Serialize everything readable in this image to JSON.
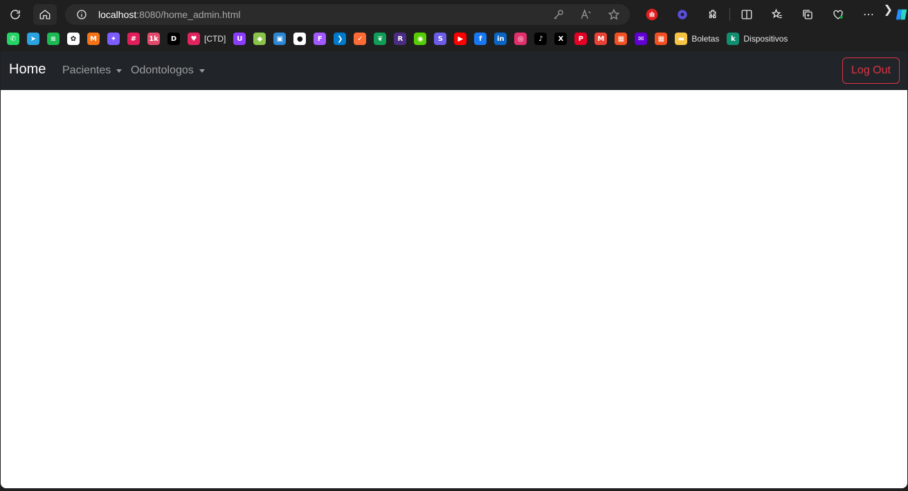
{
  "browser": {
    "address_bar": {
      "host": "localhost",
      "path": ":8080/home_admin.html"
    },
    "bookmarks": [
      {
        "icon": "whatsapp-icon",
        "color": "#25d366",
        "glyph": "✆",
        "label": ""
      },
      {
        "icon": "telegram-icon",
        "color": "#2aa3e0",
        "glyph": "➤",
        "label": ""
      },
      {
        "icon": "spotify-icon",
        "color": "#1db954",
        "glyph": "≋",
        "label": ""
      },
      {
        "icon": "chatgpt-icon",
        "color": "#ffffff",
        "glyph": "✿",
        "label": ""
      },
      {
        "icon": "m-logo-icon",
        "color": "#f97316",
        "glyph": "M",
        "label": ""
      },
      {
        "icon": "sparkle-icon",
        "color": "#7c5cff",
        "glyph": "✦",
        "label": ""
      },
      {
        "icon": "slack-icon",
        "color": "#e01e5a",
        "glyph": "#",
        "label": ""
      },
      {
        "icon": "1k-plus-icon",
        "color": "#e04b6a",
        "glyph": "1k",
        "label": ""
      },
      {
        "icon": "dm-icon",
        "color": "#000000",
        "glyph": "D",
        "label": ""
      },
      {
        "icon": "ctd-icon",
        "color": "#e0245e",
        "glyph": "♥",
        "label": "[CTD]"
      },
      {
        "icon": "purple-u-icon",
        "color": "#8b3dff",
        "glyph": "U",
        "label": ""
      },
      {
        "icon": "diamond-icon",
        "color": "#8bc34a",
        "glyph": "◆",
        "label": ""
      },
      {
        "icon": "window-icon",
        "color": "#2b87d3",
        "glyph": "▣",
        "label": ""
      },
      {
        "icon": "github-icon",
        "color": "#ffffff",
        "glyph": "●",
        "label": ""
      },
      {
        "icon": "figma-icon",
        "color": "#a259ff",
        "glyph": "F",
        "label": ""
      },
      {
        "icon": "vscode-icon",
        "color": "#007acc",
        "glyph": "❯",
        "label": ""
      },
      {
        "icon": "orange-circle-icon",
        "color": "#ff6b35",
        "glyph": "✓",
        "label": ""
      },
      {
        "icon": "green-leaf-icon",
        "color": "#0f9d58",
        "glyph": "❦",
        "label": ""
      },
      {
        "icon": "r-icon",
        "color": "#4b2e83",
        "glyph": "R",
        "label": ""
      },
      {
        "icon": "duolingo-icon",
        "color": "#58cc02",
        "glyph": "◉",
        "label": ""
      },
      {
        "icon": "s-icon",
        "color": "#6c5ce7",
        "glyph": "S",
        "label": ""
      },
      {
        "icon": "youtube-icon",
        "color": "#ff0000",
        "glyph": "▶",
        "label": ""
      },
      {
        "icon": "facebook-icon",
        "color": "#1877f2",
        "glyph": "f",
        "label": ""
      },
      {
        "icon": "linkedin-icon",
        "color": "#0a66c2",
        "glyph": "in",
        "label": ""
      },
      {
        "icon": "instagram-icon",
        "color": "#e1306c",
        "glyph": "◎",
        "label": ""
      },
      {
        "icon": "tiktok-icon",
        "color": "#000000",
        "glyph": "♪",
        "label": ""
      },
      {
        "icon": "x-icon",
        "color": "#000000",
        "glyph": "X",
        "label": ""
      },
      {
        "icon": "pinterest-icon",
        "color": "#e60023",
        "glyph": "P",
        "label": ""
      },
      {
        "icon": "gmail-icon",
        "color": "#ea4335",
        "glyph": "M",
        "label": ""
      },
      {
        "icon": "microsoft-icon",
        "color": "#f25022",
        "glyph": "▦",
        "label": ""
      },
      {
        "icon": "mail-icon",
        "color": "#6001d2",
        "glyph": "✉",
        "label": ""
      },
      {
        "icon": "microsoft-icon-2",
        "color": "#f25022",
        "glyph": "▦",
        "label": ""
      },
      {
        "icon": "folder-icon",
        "color": "#f6c343",
        "glyph": "▬",
        "label": "Boletas"
      },
      {
        "icon": "k-icon",
        "color": "#0f8f6f",
        "glyph": "k",
        "label": "Dispositivos"
      }
    ]
  },
  "navbar": {
    "brand": "Home",
    "items": [
      {
        "label": "Pacientes"
      },
      {
        "label": "Odontologos"
      }
    ],
    "logout_label": "Log Out"
  }
}
